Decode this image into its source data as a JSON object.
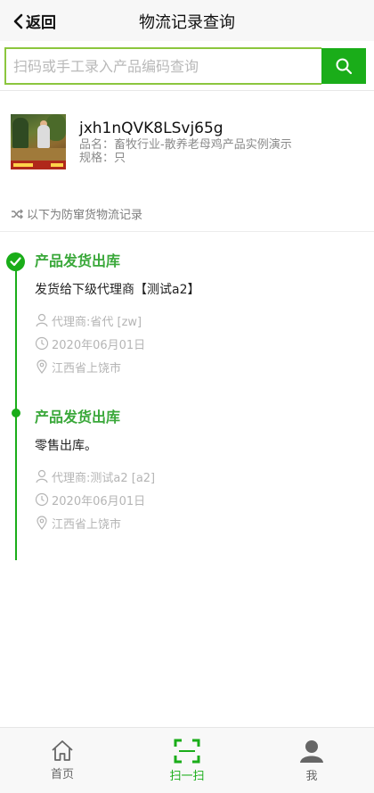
{
  "header": {
    "back_label": "返回",
    "title": "物流记录查询"
  },
  "search": {
    "placeholder": "扫码或手工录入产品编码查询",
    "value": ""
  },
  "product": {
    "code": "jxh1nQVK8LSvj65g",
    "name_line": "品名：畜牧行业-散养老母鸡产品实例演示",
    "spec_line": "规格：只"
  },
  "hint": "以下为防窜货物流记录",
  "records": [
    {
      "title": "产品发货出库",
      "desc": "发货给下级代理商【测试a2】",
      "agent": "代理商:省代 [zw]",
      "date": "2020年06月01日",
      "location": "江西省上饶市"
    },
    {
      "title": "产品发货出库",
      "desc": "零售出库。",
      "agent": "代理商:测试a2 [a2]",
      "date": "2020年06月01日",
      "location": "江西省上饶市"
    }
  ],
  "tabbar": [
    {
      "label": "首页",
      "icon": "home-icon"
    },
    {
      "label": "扫一扫",
      "icon": "scan-icon"
    },
    {
      "label": "我",
      "icon": "user-icon"
    }
  ],
  "colors": {
    "accent": "#1aad19",
    "record_title": "#3aa83a",
    "meta": "#b5b5b5"
  }
}
